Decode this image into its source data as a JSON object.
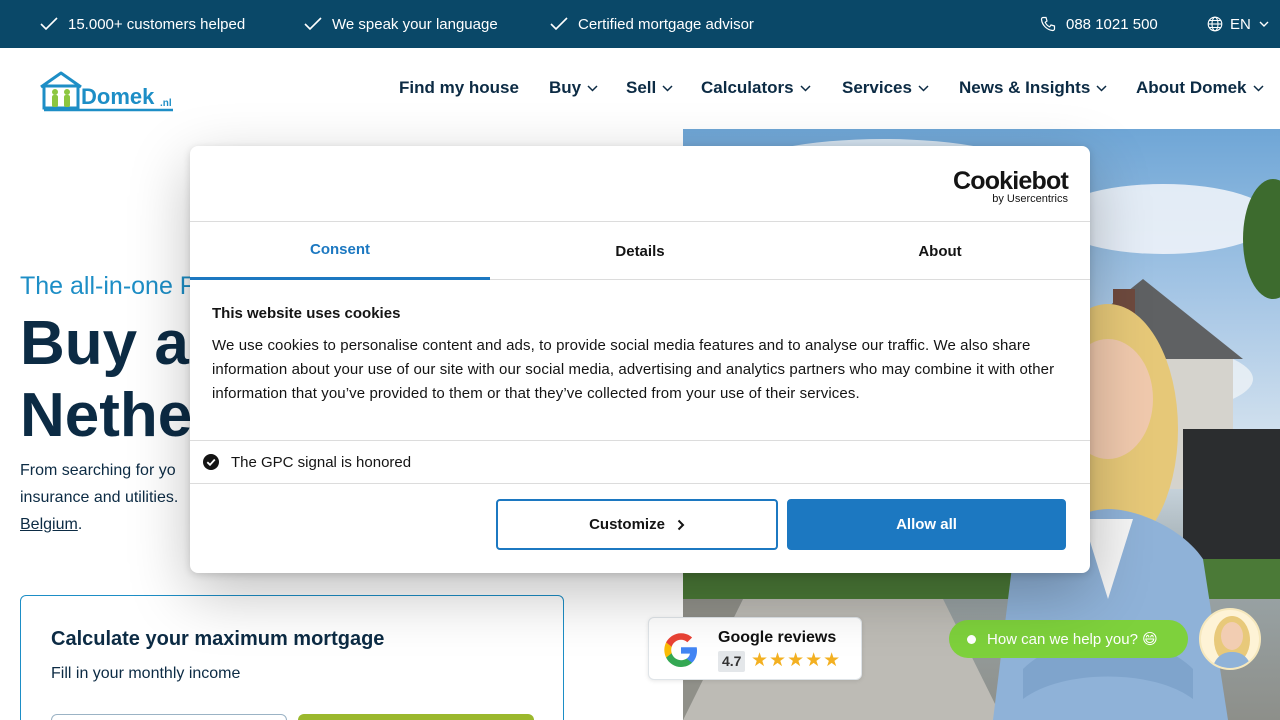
{
  "topbar": {
    "usps": [
      "15.000+ customers helped",
      "We speak your language",
      "Certified mortgage advisor"
    ],
    "phone": "088 1021 500",
    "language": "EN"
  },
  "header": {
    "logo_text": "Domek",
    "logo_suffix": ".nl",
    "nav": [
      "Find my house",
      "Buy",
      "Sell",
      "Calculators",
      "Services",
      "News & Insights",
      "About Domek"
    ]
  },
  "hero": {
    "subtitle": "The all-in-one F",
    "title_line1": "Buy a",
    "title_line2": "Nethe",
    "body_line1": "From searching for yo",
    "body_line2": "insurance and utilities.",
    "body_link": "Belgium",
    "body_end": "."
  },
  "calculator": {
    "title": "Calculate your maximum mortgage",
    "subtitle": "Fill in your monthly income"
  },
  "reviews": {
    "title": "Google reviews",
    "rating": "4.7",
    "stars": "★★★★★"
  },
  "chat": {
    "label": "How can we help you? 😄"
  },
  "cookie": {
    "brand": "Cookiebot",
    "brand_sub": "by Usercentrics",
    "tabs": [
      "Consent",
      "Details",
      "About"
    ],
    "title": "This website uses cookies",
    "text": "We use cookies to personalise content and ads, to provide social media features and to analyse our traffic. We also share information about your use of our site with our social media, advertising and analytics partners who may combine it with other information that you’ve provided to them or that they’ve collected from your use of their services.",
    "gpc": "The GPC signal is honored",
    "customize": "Customize",
    "allow_all": "Allow all"
  },
  "colors": {
    "topbar": "#0a4868",
    "accent_blue": "#1d8ec6",
    "cookie_blue": "#1c78c1",
    "chat_green": "#7ed13c",
    "calc_button": "#9bb82d"
  }
}
